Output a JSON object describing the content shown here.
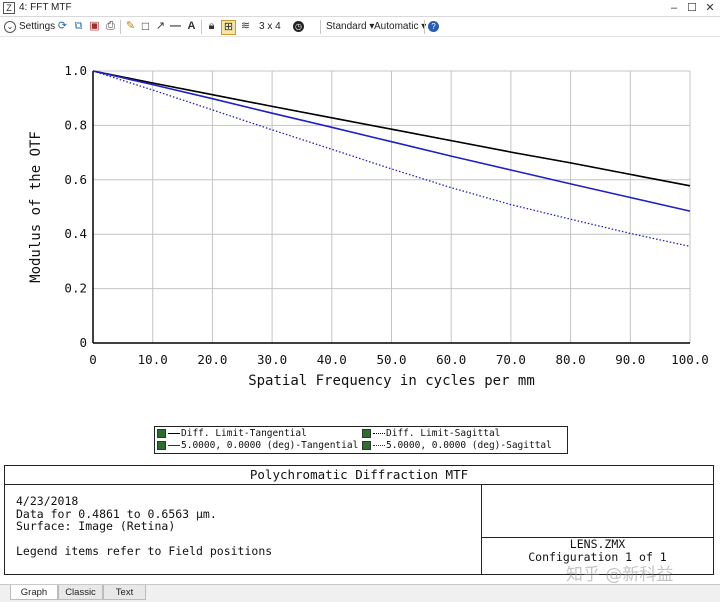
{
  "window": {
    "title": "4: FFT MTF",
    "icon": "zemax-window-icon"
  },
  "toolbar": {
    "settings_label": "Settings",
    "layout_label": "3 x 4",
    "standard_label": "Standard",
    "automatic_label": "Automatic"
  },
  "chart_data": {
    "type": "line",
    "xlabel": "Spatial Frequency in cycles per mm",
    "ylabel": "Modulus of the OTF",
    "xlim": [
      0,
      100
    ],
    "ylim": [
      0,
      1.0
    ],
    "x_ticks": [
      "0",
      "10.0",
      "20.0",
      "30.0",
      "40.0",
      "50.0",
      "60.0",
      "70.0",
      "80.0",
      "90.0",
      "100.0"
    ],
    "y_ticks": [
      "0",
      "0.2",
      "0.4",
      "0.6",
      "0.8",
      "1.0"
    ],
    "grid": true,
    "x": [
      0,
      10,
      20,
      30,
      40,
      50,
      60,
      70,
      80,
      90,
      100
    ],
    "series": [
      {
        "name": "Diff. Limit-Tangential",
        "color": "#000000",
        "style": "solid",
        "values": [
          1.0,
          0.956,
          0.913,
          0.87,
          0.828,
          0.786,
          0.744,
          0.702,
          0.662,
          0.62,
          0.578
        ]
      },
      {
        "name": "Diff. Limit-Sagittal",
        "color": "#000000",
        "style": "dotted",
        "values": [
          1.0,
          0.956,
          0.913,
          0.87,
          0.828,
          0.786,
          0.744,
          0.702,
          0.662,
          0.62,
          0.578
        ]
      },
      {
        "name": "5.0000, 0.0000 (deg)-Tangential",
        "color": "#2020c0",
        "style": "solid",
        "values": [
          1.0,
          0.95,
          0.898,
          0.845,
          0.793,
          0.74,
          0.687,
          0.636,
          0.585,
          0.535,
          0.485
        ]
      },
      {
        "name": "5.0000, 0.0000 (deg)-Sagittal",
        "color": "#2020c0",
        "style": "dotted",
        "values": [
          1.0,
          0.93,
          0.857,
          0.784,
          0.712,
          0.64,
          0.571,
          0.509,
          0.455,
          0.403,
          0.355
        ]
      }
    ]
  },
  "legend": {
    "items": [
      "Diff. Limit-Tangential",
      "Diff. Limit-Sagittal",
      "5.0000, 0.0000 (deg)-Tangential",
      "5.0000, 0.0000 (deg)-Sagittal"
    ]
  },
  "info": {
    "title": "Polychromatic Diffraction MTF",
    "date": "4/23/2018",
    "data_range": "Data for 0.4861 to 0.6563 µm.",
    "surface": "Surface: Image (Retina)",
    "legend_note": "Legend items refer to Field positions",
    "file": "LENS.ZMX",
    "configuration": "Configuration 1 of 1"
  },
  "tabs": [
    "Graph",
    "Classic",
    "Text"
  ],
  "watermark": "知乎 @新科益"
}
